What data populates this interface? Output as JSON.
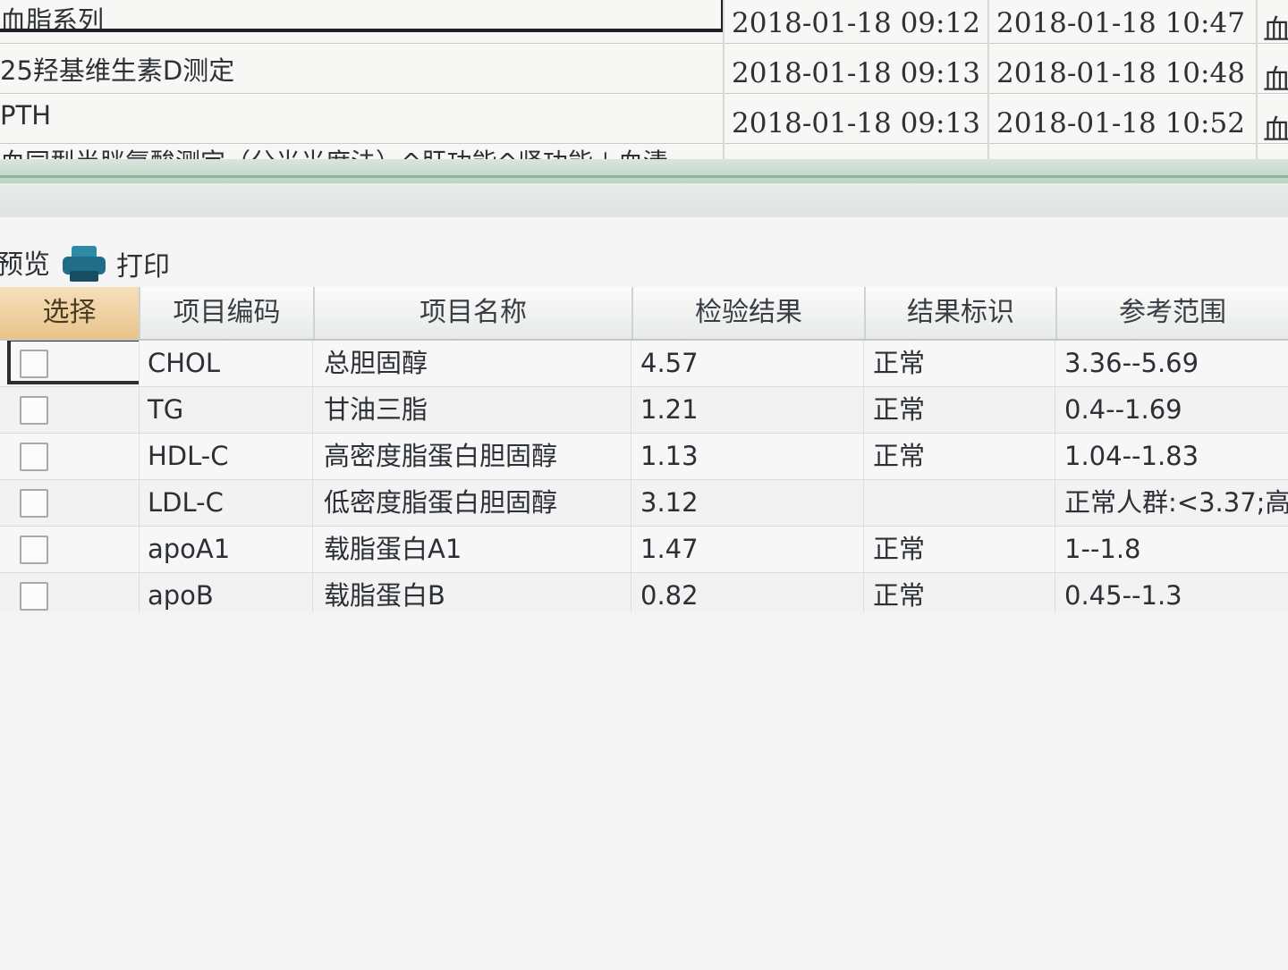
{
  "top_list": {
    "rows": [
      {
        "name": "血脂系列",
        "time1": "2018-01-18 09:12",
        "time2": "2018-01-18 10:47",
        "time3": "血"
      },
      {
        "name": "25羟基维生素D测定",
        "time1": "2018-01-18 09:13",
        "time2": "2018-01-18 10:48",
        "time3": "血"
      },
      {
        "name": "PTH",
        "time1": "2018-01-18 09:13",
        "time2": "2018-01-18 10:52",
        "time3": "血"
      },
      {
        "name": "血同型半胱氨酸测定（分光光度法）^肝功能^肾功能＋血清",
        "time1": "",
        "time2": "",
        "time3": ""
      }
    ]
  },
  "toolbar": {
    "preview_label": "预览",
    "print_label": "打印"
  },
  "grid": {
    "headers": {
      "select": "选择",
      "code": "项目编码",
      "name": "项目名称",
      "result": "检验结果",
      "flag": "结果标识",
      "range": "参考范围"
    },
    "rows": [
      {
        "code": "CHOL",
        "name": "总胆固醇",
        "result": "4.57",
        "flag": "正常",
        "range": "3.36--5.69"
      },
      {
        "code": "TG",
        "name": "甘油三脂",
        "result": "1.21",
        "flag": "正常",
        "range": "0.4--1.69"
      },
      {
        "code": "HDL-C",
        "name": "高密度脂蛋白胆固醇",
        "result": "1.13",
        "flag": "正常",
        "range": "1.04--1.83"
      },
      {
        "code": "LDL-C",
        "name": "低密度脂蛋白胆固醇",
        "result": "3.12",
        "flag": "",
        "range": "正常人群:<3.37;高"
      },
      {
        "code": "apoA1",
        "name": "载脂蛋白A1",
        "result": "1.47",
        "flag": "正常",
        "range": "1--1.8"
      },
      {
        "code": "apoB",
        "name": "载脂蛋白B",
        "result": "0.82",
        "flag": "正常",
        "range": "0.45--1.3"
      }
    ]
  }
}
